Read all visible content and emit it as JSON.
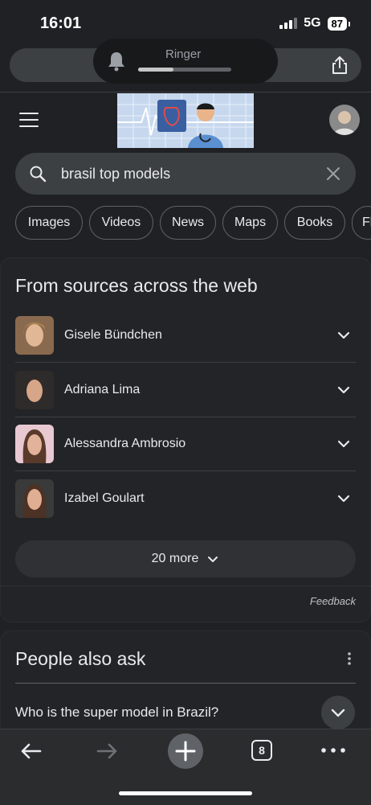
{
  "status": {
    "time": "16:01",
    "network": "5G",
    "battery": "87"
  },
  "ringer": {
    "label": "Ringer",
    "level": 0.38
  },
  "search": {
    "query": "brasil top models"
  },
  "chips": [
    "Images",
    "Videos",
    "News",
    "Maps",
    "Books",
    "Fl"
  ],
  "sources_card": {
    "title": "From sources across the web",
    "items": [
      "Gisele Bündchen",
      "Adriana Lima",
      "Alessandra Ambrosio",
      "Izabel Goulart"
    ],
    "more_label": "20 more",
    "feedback": "Feedback"
  },
  "paa": {
    "title": "People also ask",
    "question": "Who is the super model in Brazil?"
  },
  "bottom": {
    "tab_count": "8"
  },
  "colors": {
    "background": "#202124",
    "surface": "#3c4043",
    "text": "#e8eaed"
  }
}
